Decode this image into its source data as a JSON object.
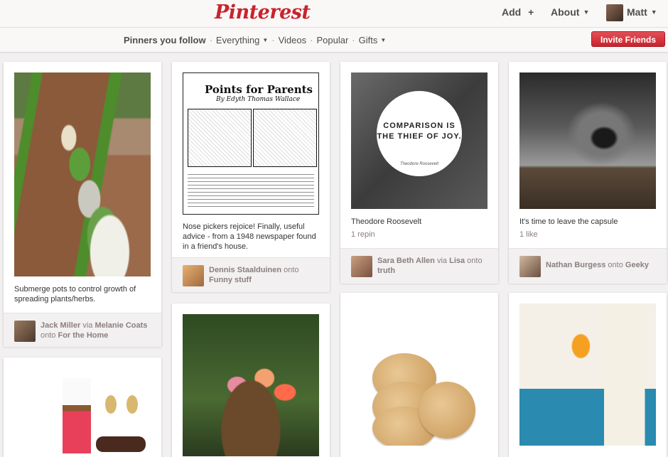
{
  "header": {
    "logo": "Pinterest",
    "add_label": "Add",
    "add_symbol": "+",
    "about_label": "About",
    "user_name": "Matt"
  },
  "subnav": {
    "items": [
      "Pinners you follow",
      "Everything",
      "Videos",
      "Popular",
      "Gifts"
    ],
    "separator": "·",
    "invite_label": "Invite Friends"
  },
  "pins": [
    {
      "description": "Submerge pots to control growth of spreading plants/herbs.",
      "credit": {
        "user": "Jack Miller",
        "via_word": "via",
        "via_user": "Melanie Coats",
        "onto_word": "onto",
        "board": "For the Home"
      }
    },
    {
      "comic_title": "Points for Parents",
      "comic_byline": "By Edyth Thomas Wallace",
      "description": "Nose pickers rejoice! Finally, useful advice - from a 1948 newspaper found in a friend's house.",
      "credit": {
        "user": "Dennis Staalduinen",
        "onto_word": "onto",
        "board": "Funny stuff"
      }
    },
    {
      "quote_text": "COMPARISON IS THE THIEF OF JOY.",
      "quote_author": "Theodore Roosevelt",
      "description": "Theodore Roosevelt",
      "stat": "1 repin",
      "credit": {
        "user": "Sara Beth Allen",
        "via_word": "via",
        "via_user": "Lisa",
        "onto_word": "onto",
        "board": "truth"
      }
    },
    {
      "description": "It's time to leave the capsule",
      "stat": "1 like",
      "credit": {
        "user": "Nathan Burgess",
        "onto_word": "onto",
        "board": "Geeky"
      }
    }
  ],
  "colors": {
    "brand": "#c8232c",
    "background": "#f2f0f0",
    "credit_text": "#8c7e7e"
  }
}
